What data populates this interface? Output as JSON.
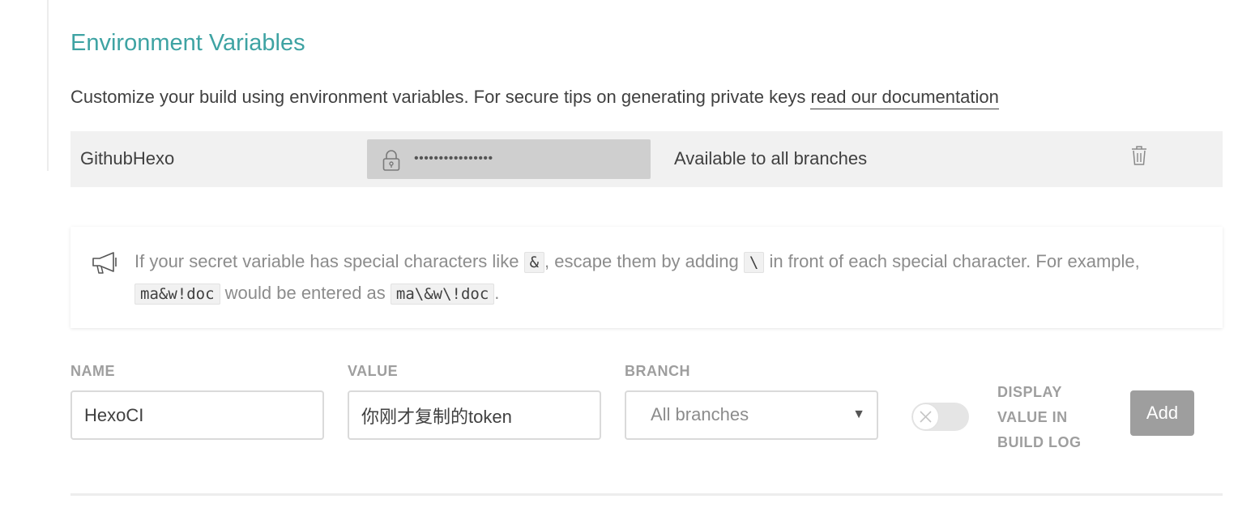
{
  "header": {
    "title": "Environment Variables",
    "description_prefix": "Customize your build using environment variables. For secure tips on generating private keys",
    "doc_link": "read our documentation"
  },
  "variables": [
    {
      "name": "GithubHexo",
      "value_masked": "••••••••••••••••",
      "branches": "Available to all branches"
    }
  ],
  "notice": {
    "part1": "If your secret variable has special characters like",
    "code1": "&",
    "part2": ", escape them by adding",
    "code2": "\\",
    "part3": "in front of each special character. For example,",
    "code3": "ma&w!doc",
    "part4": "would be entered as",
    "code4": "ma\\&w\\!doc",
    "part5": "."
  },
  "form": {
    "name_label": "NAME",
    "name_value": "HexoCI",
    "value_label": "VALUE",
    "value_value": "你刚才复制的token",
    "branch_label": "BRANCH",
    "branch_selected": "All branches",
    "display_line1": "DISPLAY",
    "display_line2": "VALUE IN",
    "display_line3": "BUILD LOG",
    "display_toggle_on": false,
    "add_label": "Add"
  },
  "icons": {
    "lock": "lock-icon",
    "trash": "trash-icon",
    "megaphone": "megaphone-icon",
    "dropdown": "triangle-down-icon",
    "toggle_off": "close-icon"
  },
  "colors": {
    "accent": "#3ea3a3",
    "row_background": "#f1f1f1",
    "masked_value_background": "#cfcfcf",
    "button_disabled": "#9e9e9e"
  }
}
